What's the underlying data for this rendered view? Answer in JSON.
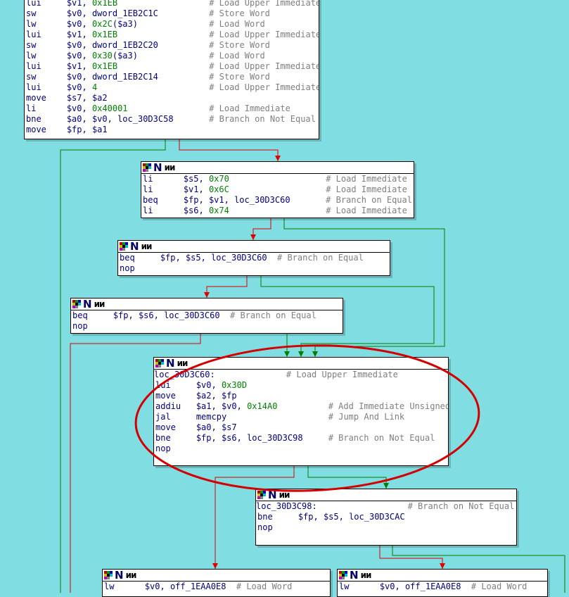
{
  "colors": {
    "background": "#80dde2",
    "true_edge": "#008000",
    "false_edge": "#e00000",
    "jump_edge": "#008000",
    "number": "#008000",
    "comment": "#7f7f7f",
    "mnemonic": "#000080",
    "highlight_ellipse": "#d40000"
  },
  "node_header_icons": [
    "graph-grid-icon",
    "name-n-icon",
    "xref-wave-icon"
  ],
  "nodes": [
    {
      "id": "block1",
      "lines": [
        {
          "mn": "lui",
          "ops": "$v1, ",
          "num": "0x1EB",
          "cmt": "# Load Upper Immediate"
        },
        {
          "mn": "sw",
          "ops": "$v0, dword_1EB2C1C",
          "num": "",
          "cmt": "# Store Word"
        },
        {
          "mn": "lw",
          "ops": "$v0, ",
          "num": "0x2C",
          "tail": "($a3)",
          "cmt": "# Load Word"
        },
        {
          "mn": "lui",
          "ops": "$v1, ",
          "num": "0x1EB",
          "cmt": "# Load Upper Immediate"
        },
        {
          "mn": "sw",
          "ops": "$v0, dword_1EB2C20",
          "num": "",
          "cmt": "# Store Word"
        },
        {
          "mn": "lw",
          "ops": "$v0, ",
          "num": "0x30",
          "tail": "($a3)",
          "cmt": "# Load Word"
        },
        {
          "mn": "lui",
          "ops": "$v1, ",
          "num": "0x1EB",
          "cmt": "# Load Upper Immediate"
        },
        {
          "mn": "sw",
          "ops": "$v0, dword_1EB2C14",
          "num": "",
          "cmt": "# Store Word"
        },
        {
          "mn": "lui",
          "ops": "$v0, ",
          "num": "4",
          "cmt": "# Load Upper Immediate"
        },
        {
          "mn": "move",
          "ops": "$s7, $a2",
          "num": "",
          "cmt": ""
        },
        {
          "mn": "li",
          "ops": "$v0, ",
          "num": "0x40001",
          "cmt": "# Load Immediate"
        },
        {
          "mn": "bne",
          "ops": "$a0, $v0, loc_30D3C58",
          "num": "",
          "cmt": "# Branch on Not Equal"
        },
        {
          "mn": "move",
          "ops": "$fp, $a1",
          "num": "",
          "cmt": ""
        }
      ]
    },
    {
      "id": "block2",
      "lines": [
        {
          "mn": "li",
          "ops": "$s5, ",
          "num": "0x70",
          "cmt": "# Load Immediate"
        },
        {
          "mn": "li",
          "ops": "$v1, ",
          "num": "0x6C",
          "cmt": "# Load Immediate"
        },
        {
          "mn": "beq",
          "ops": "$fp, $v1, loc_30D3C60",
          "num": "",
          "cmt": "# Branch on Equal"
        },
        {
          "mn": "li",
          "ops": "$s6, ",
          "num": "0x74",
          "cmt": "# Load Immediate"
        }
      ]
    },
    {
      "id": "block3",
      "lines": [
        {
          "mn": "beq",
          "ops": "$fp, $s5, loc_30D3C60",
          "num": "",
          "cmt": "# Branch on Equal"
        },
        {
          "mn": "nop",
          "ops": "",
          "num": "",
          "cmt": ""
        }
      ]
    },
    {
      "id": "block4",
      "lines": [
        {
          "mn": "beq",
          "ops": "$fp, $s6, loc_30D3C60",
          "num": "",
          "cmt": "# Branch on Equal"
        },
        {
          "mn": "nop",
          "ops": "",
          "num": "",
          "cmt": ""
        }
      ]
    },
    {
      "id": "block5",
      "label": "loc_30D3C60:",
      "label_cmt": "# Load Upper Immediate",
      "lines": [
        {
          "mn": "lui",
          "ops": "$v0, ",
          "num": "0x30D",
          "cmt": ""
        },
        {
          "mn": "move",
          "ops": "$a2, $fp",
          "num": "",
          "cmt": ""
        },
        {
          "mn": "addiu",
          "ops": "$a1, $v0, ",
          "num": "0x14A0",
          "cmt": "# Add Immediate Unsigned"
        },
        {
          "mn": "jal",
          "ops": "memcpy",
          "num": "",
          "cmt": "# Jump And Link"
        },
        {
          "mn": "move",
          "ops": "$a0, $s7",
          "num": "",
          "cmt": ""
        },
        {
          "mn": "bne",
          "ops": "$fp, $s6, loc_30D3C98",
          "num": "",
          "cmt": "# Branch on Not Equal"
        },
        {
          "mn": "nop",
          "ops": "",
          "num": "",
          "cmt": ""
        }
      ]
    },
    {
      "id": "block6",
      "label": "loc_30D3C98:",
      "label_cmt": "# Branch on Not Equal",
      "lines": [
        {
          "mn": "bne",
          "ops": "$fp, $s5, loc_30D3CAC",
          "num": "",
          "cmt": ""
        },
        {
          "mn": "nop",
          "ops": "",
          "num": "",
          "cmt": ""
        }
      ]
    },
    {
      "id": "block7",
      "lines": [
        {
          "mn": "lw",
          "ops": "$v0, off_1EAA0E8",
          "num": "",
          "cmt": "# Load Word"
        }
      ]
    },
    {
      "id": "block8",
      "lines": [
        {
          "mn": "lw",
          "ops": "$v0, off_1EAA0E8",
          "num": "",
          "cmt": "# Load Word"
        }
      ]
    }
  ]
}
